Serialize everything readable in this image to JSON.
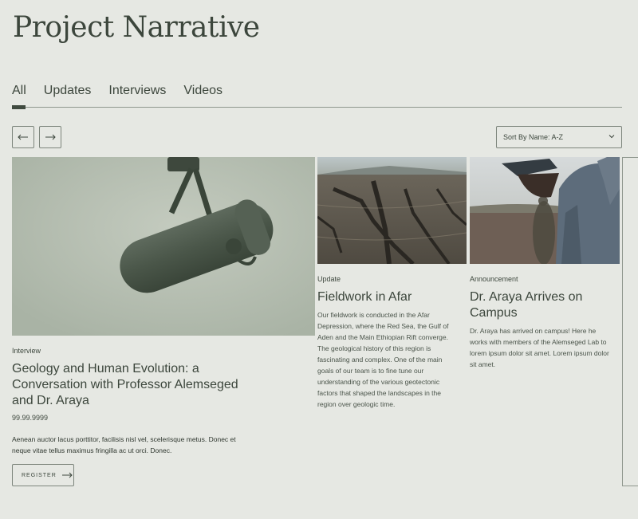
{
  "page": {
    "title": "Project Narrative"
  },
  "tabs": [
    {
      "label": "All",
      "active": true
    },
    {
      "label": "Updates",
      "active": false
    },
    {
      "label": "Interviews",
      "active": false
    },
    {
      "label": "Videos",
      "active": false
    }
  ],
  "controls": {
    "prev_icon": "arrow-left-icon",
    "next_icon": "arrow-right-icon",
    "sort_label": "Sort By Name: A-Z",
    "sort_icon": "chevron-down-icon"
  },
  "cards": [
    {
      "kicker": "Interview",
      "title": "Geology and Human Evolution: a Conversation with Professor Alemseged and Dr. Araya",
      "date": "99.99.9999",
      "description": "Aenean auctor lacus porttitor, facilisis nisl vel, scelerisque metus. Donec et neque vitae tellus maximus fringilla ac ut orci. Donec.",
      "button_label": "REGISTER",
      "image": "microphone-image"
    },
    {
      "kicker": "Update",
      "title": "Fieldwork in Afar",
      "description": "Our fieldwork is conducted in the Afar Depression, where the Red Sea, the Gulf of Aden and the Main Ethiopian Rift converge. The geological history of this region is fascinating and complex. One of the main goals of our team is to fine tune our understanding of the various geotectonic factors that shaped the landscapes in the region over geologic time.",
      "image": "rift-landscape-image"
    },
    {
      "kicker": "Announcement",
      "title": "Dr. Araya Arrives on Campus",
      "description": "Dr. Araya has arrived on campus! Here he works with members of the Alemseged Lab to lorem ipsum dolor sit amet. Lorem ipsum dolor sit amet.",
      "image": "field-researcher-image"
    }
  ],
  "colors": {
    "background": "#e6e8e3",
    "text": "#3c463c",
    "accent": "#3f4a3f",
    "border": "#7d857c"
  }
}
